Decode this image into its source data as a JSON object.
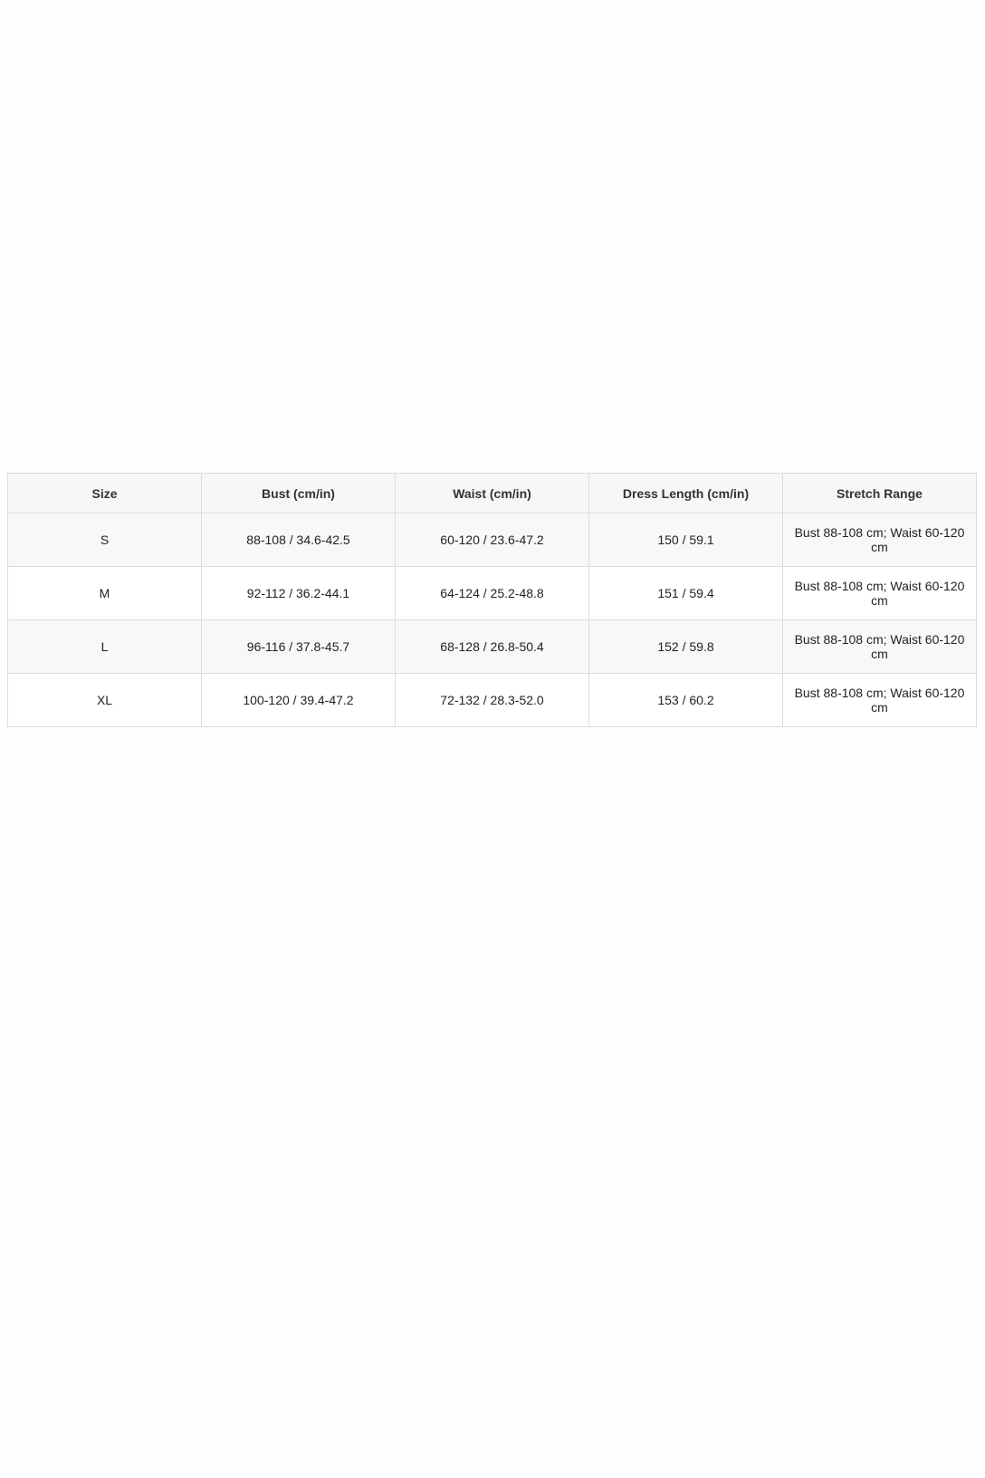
{
  "size_chart": {
    "headers": [
      "Size",
      "Bust (cm/in)",
      "Waist (cm/in)",
      "Dress Length (cm/in)",
      "Stretch Range"
    ],
    "rows": [
      [
        "S",
        "88-108 / 34.6-42.5",
        "60-120 / 23.6-47.2",
        "150 / 59.1",
        "Bust 88-108 cm; Waist 60-120 cm"
      ],
      [
        "M",
        "92-112 / 36.2-44.1",
        "64-124 / 25.2-48.8",
        "151 / 59.4",
        "Bust 88-108 cm; Waist 60-120 cm"
      ],
      [
        "L",
        "96-116 / 37.8-45.7",
        "68-128 / 26.8-50.4",
        "152 / 59.8",
        "Bust 88-108 cm; Waist 60-120 cm"
      ],
      [
        "XL",
        "100-120 / 39.4-47.2",
        "72-132 / 28.3-52.0",
        "153 / 60.2",
        "Bust 88-108 cm; Waist 60-120 cm"
      ]
    ]
  }
}
